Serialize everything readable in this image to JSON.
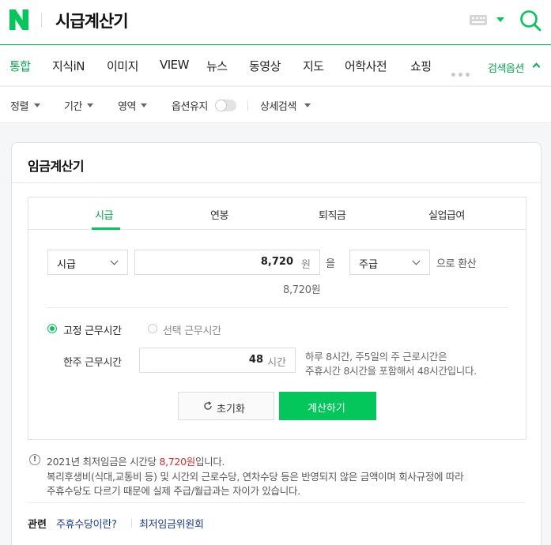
{
  "header": {
    "title": "시급계산기",
    "logo_icon": "naver-n-logo-icon",
    "keyboard_icon": "keyboard-icon",
    "search_icon": "search-icon"
  },
  "nav": {
    "items": [
      "통합",
      "지식iN",
      "이미지",
      "VIEW",
      "뉴스",
      "동영상",
      "지도",
      "어학사전",
      "쇼핑"
    ],
    "active": "통합",
    "search_options": "검색옵션"
  },
  "options": {
    "sort": "정렬",
    "period": "기간",
    "area": "영역",
    "keep_options": "옵션유지",
    "keep_options_on": false,
    "advanced": "상세검색"
  },
  "card": {
    "title": "임금계산기",
    "tabs": [
      "시급",
      "연봉",
      "퇴직금",
      "실업급여"
    ],
    "active_tab": "시급",
    "from_unit": "시급",
    "amount": "8,720",
    "amount_unit": "원",
    "particle": "을",
    "to_unit": "주급",
    "convert_suffix": "으로 환산",
    "amount_hint": "8,720원",
    "radio_fixed": "고정 근무시간",
    "radio_select": "선택 근무시간",
    "weekly_label": "한주 근무시간",
    "weekly_hours": "48",
    "hours_unit": "시간",
    "hours_note_1": "하루 8시간, 주5일의 주 근로시간은",
    "hours_note_2": "주휴시간 8시간을 포함해서 48시간입니다.",
    "reset_button": "초기화",
    "calc_button": "계산하기"
  },
  "notice": {
    "line1_pre": "2021년 최저임금은 시간당 ",
    "line1_wage": "8,720원",
    "line1_post": "입니다.",
    "line2": "복리후생비(식대,교통비 등) 및 시간외 근로수당, 연차수당 등은 반영되지 않은 금액이며 회사규정에 따라",
    "line3": "주휴수당도 다르기 때문에 실제 주급/월급과는 자이가 있습니다."
  },
  "related": {
    "label": "관련",
    "links": [
      "주휴수당이란?",
      "최저임금위원회"
    ]
  },
  "colors": {
    "brand": "#03c75a",
    "accent_text": "#03a94d",
    "wage_red": "#e02d2d",
    "link_blue": "#1a3d9c"
  }
}
